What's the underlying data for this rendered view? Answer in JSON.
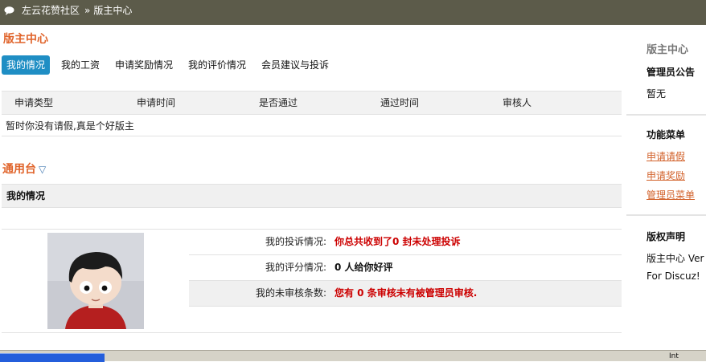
{
  "breadcrumb": {
    "community": "左云花赞社区",
    "separator": "»",
    "current": "版主中心"
  },
  "page_title": "版主中心",
  "tabs": [
    {
      "label": "我的情况",
      "active": true
    },
    {
      "label": "我的工资",
      "active": false
    },
    {
      "label": "申请奖励情况",
      "active": false
    },
    {
      "label": "我的评价情况",
      "active": false
    },
    {
      "label": "会员建议与投诉",
      "active": false
    }
  ],
  "leave_table": {
    "columns": [
      "申请类型",
      "申请时间",
      "是否通过",
      "通过时间",
      "审核人"
    ],
    "empty_message": "暂时你没有请假,真是个好版主"
  },
  "general": {
    "title": "通用台",
    "toggle_icon": "triangle-down-icon"
  },
  "my_status": {
    "header": "我的情况",
    "rows": [
      {
        "label": "我的投诉情况:",
        "value": "你总共收到了0 封未处理投诉",
        "color": "#cc0000"
      },
      {
        "label": "我的评分情况:",
        "value": "0 人给你好评",
        "color": "#111111"
      },
      {
        "label": "我的未审核条数:",
        "value": "您有  0 条审核未有被管理员审核.",
        "color": "#cc0000"
      }
    ]
  },
  "sidebar": {
    "title": "版主中心",
    "announcement_heading": "管理员公告",
    "announcement_text": "暂无",
    "menu_heading": "功能菜单",
    "menu_links": [
      "申请请假",
      "申请奖励",
      "管理员菜单"
    ],
    "copyright_heading": "版权声明",
    "copyright_line1": "版主中心  Ver",
    "copyright_line2": "For Discuz!"
  },
  "taskbar": {
    "tray_text": "Int"
  },
  "colors": {
    "topbar": "#5c5b4a",
    "accent_orange": "#e0642b",
    "tab_active": "#1f8ec4",
    "link": "#d2612a",
    "alert_red": "#cc0000"
  }
}
